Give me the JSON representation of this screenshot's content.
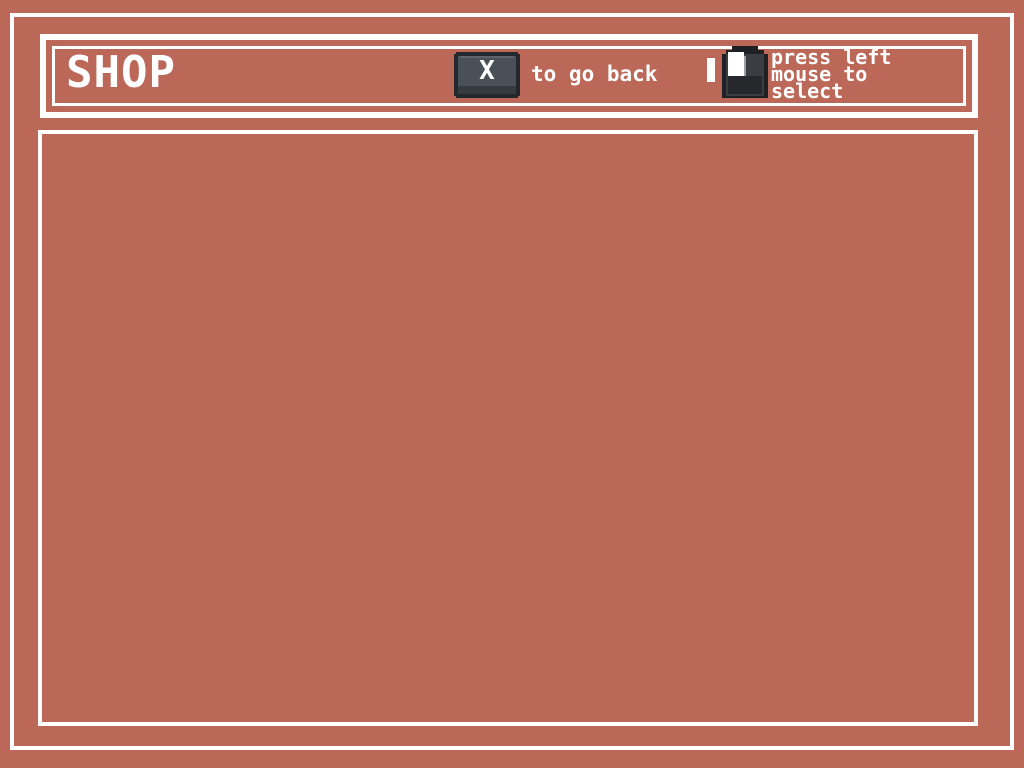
{
  "header": {
    "title": "SHOP",
    "back_key_label": "X",
    "back_hint": "to go back",
    "select_hint": "press left\nmouse to\nselect"
  },
  "icons": {
    "back_key": "keyboard-x-key-icon",
    "mouse": "mouse-left-button-icon"
  },
  "colors": {
    "background": "#bc6858",
    "frame": "#ffffff",
    "key": "#4a5057"
  }
}
